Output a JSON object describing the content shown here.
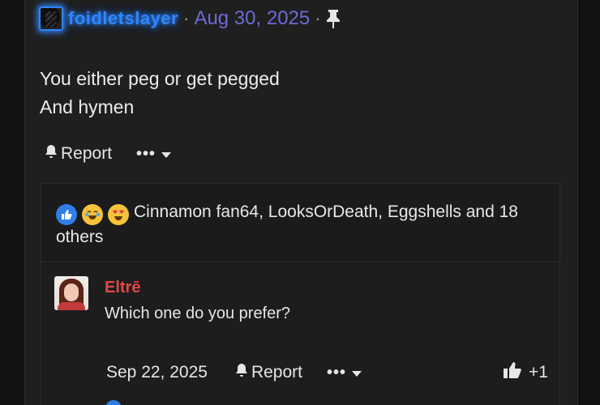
{
  "post": {
    "username": "foidletslayer",
    "date": "Aug 30, 2025",
    "separator": "·",
    "body_lines": [
      "You either peg or get pegged",
      "And hymen"
    ],
    "report_label": "Report",
    "more_dots": "•••"
  },
  "reactions": {
    "icons": [
      "like-icon",
      "laugh-cry-icon",
      "heart-eyes-icon"
    ],
    "text": "Cinnamon fan64, LooksOrDeath, Eggshells and 18 others"
  },
  "reply": {
    "username": "Eltrē",
    "text": "Which one do you prefer?",
    "date": "Sep 22, 2025",
    "report_label": "Report",
    "more_dots": "•••",
    "like_count": "+1"
  },
  "colors": {
    "accent_blue": "#2e86ff",
    "date_purple": "#6b6bd6",
    "reply_user_red": "#e04848",
    "background": "#1f1f1f"
  }
}
